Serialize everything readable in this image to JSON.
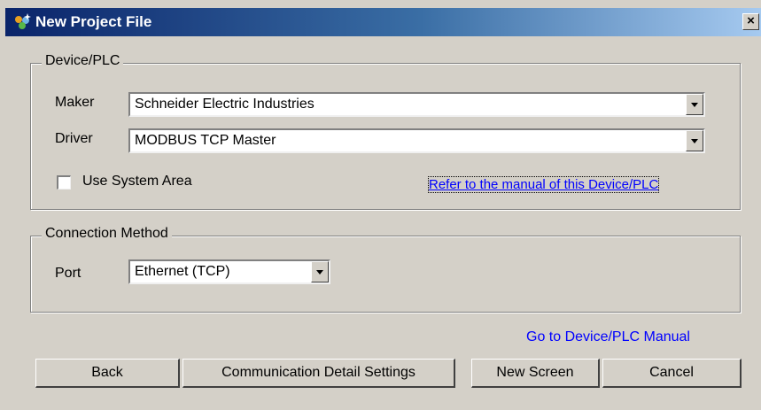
{
  "window": {
    "title": "New Project File",
    "close_label": "×"
  },
  "device_plc": {
    "group_label": "Device/PLC",
    "maker_label": "Maker",
    "maker_value": "Schneider Electric Industries",
    "driver_label": "Driver",
    "driver_value": "MODBUS TCP Master",
    "use_system_area_label": "Use System Area",
    "use_system_area_checked": false,
    "manual_link": "Refer to the manual of this Device/PLC"
  },
  "connection": {
    "group_label": "Connection Method",
    "port_label": "Port",
    "port_value": "Ethernet (TCP)"
  },
  "goto_manual_link": "Go to Device/PLC Manual",
  "buttons": {
    "back": "Back",
    "comm_settings": "Communication Detail Settings",
    "new_screen": "New Screen",
    "cancel": "Cancel"
  },
  "colors": {
    "titlebar_start": "#0a246a",
    "titlebar_end": "#a6caf0",
    "link": "#0000ff",
    "face": "#d4d0c8"
  }
}
